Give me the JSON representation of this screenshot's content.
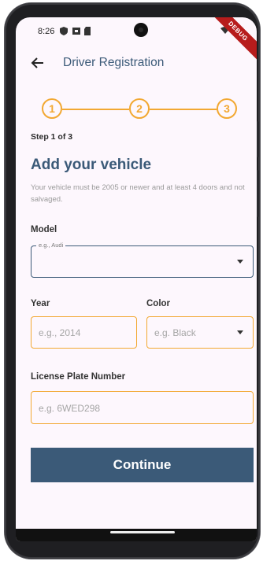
{
  "status_bar": {
    "time": "8:26",
    "debug_label": "DEBUG"
  },
  "app_bar": {
    "title": "Driver Registration"
  },
  "stepper": {
    "steps": [
      "1",
      "2",
      "3"
    ],
    "current": 1
  },
  "step_label": "Step 1 of 3",
  "heading": "Add your vehicle",
  "subtext": "Your vehicle must be 2005 or newer and at least 4 doors and not salvaged.",
  "model": {
    "label": "Model",
    "placeholder": "e.g., Audi"
  },
  "year": {
    "label": "Year",
    "placeholder": "e.g., 2014"
  },
  "color": {
    "label": "Color",
    "placeholder": "e.g. Black"
  },
  "license": {
    "label": "License Plate Number",
    "placeholder": "e.g. 6WED298"
  },
  "continue_label": "Continue",
  "colors": {
    "primary": "#3b5a78",
    "accent": "#f2a832",
    "background": "#fdf7fd"
  }
}
